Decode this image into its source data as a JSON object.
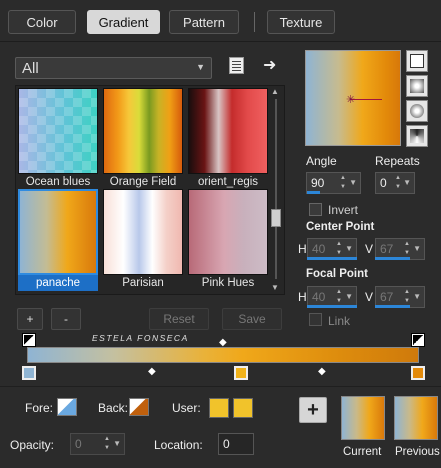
{
  "tabs": [
    {
      "label": "Color"
    },
    {
      "label": "Gradient"
    },
    {
      "label": "Pattern"
    },
    {
      "label": "Texture"
    }
  ],
  "category_dropdown": {
    "value": "All"
  },
  "swatches": [
    {
      "name": "Ocean blues"
    },
    {
      "name": "Orange Field"
    },
    {
      "name": "orient_regis"
    },
    {
      "name": "panache"
    },
    {
      "name": "Parisian"
    },
    {
      "name": "Pink Hues"
    }
  ],
  "buttons": {
    "add": "+",
    "remove": "-",
    "reset": "Reset",
    "save": "Save",
    "add_swatch": "+"
  },
  "angle": {
    "label": "Angle",
    "value": "90"
  },
  "repeats": {
    "label": "Repeats",
    "value": "0"
  },
  "invert": {
    "label": "Invert"
  },
  "center_point": {
    "label": "Center Point",
    "h_label": "H",
    "h_value": "40",
    "v_label": "V",
    "v_value": "67"
  },
  "focal_point": {
    "label": "Focal Point",
    "h_label": "H",
    "h_value": "40",
    "v_label": "V",
    "v_value": "67"
  },
  "link": {
    "label": "Link"
  },
  "watermark": "ESTELA FONSECA",
  "fore": {
    "label": "Fore:"
  },
  "back": {
    "label": "Back:"
  },
  "user": {
    "label": "User:"
  },
  "opacity": {
    "label": "Opacity:",
    "value": "0"
  },
  "location": {
    "label": "Location:",
    "value": "0"
  },
  "current": {
    "label": "Current"
  },
  "previous": {
    "label": "Previous"
  },
  "colors": {
    "accent": "#2c86d8",
    "user_swatch": "#f1c32b",
    "back_swatch": "#c0600d"
  }
}
